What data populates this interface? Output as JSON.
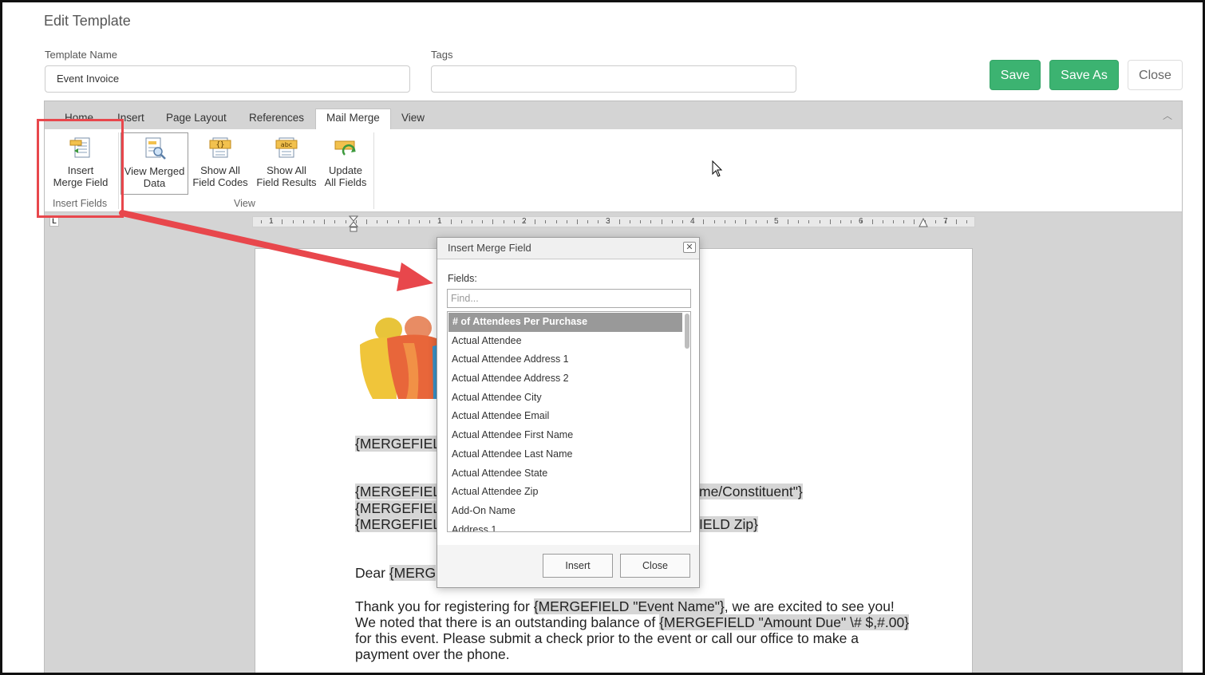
{
  "header": {
    "title": "Edit Template"
  },
  "form": {
    "template_name_label": "Template Name",
    "template_name_value": "Event Invoice",
    "tags_label": "Tags",
    "tags_value": ""
  },
  "actions": {
    "save": "Save",
    "save_as": "Save As",
    "close": "Close"
  },
  "colors": {
    "accent": "#3cb371",
    "highlight": "#e8474c"
  },
  "tabs": [
    {
      "label": "Home"
    },
    {
      "label": "Insert"
    },
    {
      "label": "Page Layout"
    },
    {
      "label": "References"
    },
    {
      "label": "Mail Merge"
    },
    {
      "label": "View"
    }
  ],
  "ribbon": {
    "insert_merge_field": {
      "line1": "Insert",
      "line2": "Merge Field"
    },
    "view_merged_data": {
      "line1": "View Merged",
      "line2": "Data"
    },
    "show_field_codes": {
      "line1": "Show All",
      "line2": "Field Codes"
    },
    "show_field_results": {
      "line1": "Show All",
      "line2": "Field Results"
    },
    "update_fields": {
      "line1": "Update",
      "line2": "All Fields"
    },
    "group_insert_fields": "Insert Fields",
    "group_view": "View"
  },
  "ruler": {
    "numbers": [
      "1",
      "1",
      "2",
      "3",
      "4",
      "5",
      "6",
      "7"
    ],
    "corner": "L"
  },
  "document": {
    "line_mergefield_1": "{MERGEFIEL",
    "line_mergefield_2": "{MERGEFIEL",
    "line_mergefield_2_tail": "me/Constituent\"}",
    "line_mergefield_3": "{MERGEFIEL",
    "line_mergefield_4": "{MERGEFIEL",
    "line_mergefield_4_tail": "IELD Zip}",
    "dear": "Dear ",
    "dear_field": "{MERG",
    "p1_a": "Thank you for registering for ",
    "p1_field": "{MERGEFIELD \"Event Name\"}",
    "p1_b": ", we are excited to see you!",
    "p2_a": "We noted that there is an outstanding balance of ",
    "p2_field": "{MERGEFIELD \"Amount Due\" \\# $,#.00}",
    "p3": "for this event.  Please submit a check prior to the event or call our office to make a",
    "p4": "payment over the phone."
  },
  "dialog": {
    "title": "Insert Merge Field",
    "close_glyph": "✕",
    "fields_label": "Fields:",
    "find_placeholder": "Find...",
    "items": [
      "# of Attendees Per Purchase",
      "Actual Attendee",
      "Actual Attendee Address 1",
      "Actual Attendee Address 2",
      "Actual Attendee City",
      "Actual Attendee Email",
      "Actual Attendee First Name",
      "Actual Attendee Last Name",
      "Actual Attendee State",
      "Actual Attendee Zip",
      "Add-On Name",
      "Address 1"
    ],
    "insert_button": "Insert",
    "close_button": "Close"
  }
}
